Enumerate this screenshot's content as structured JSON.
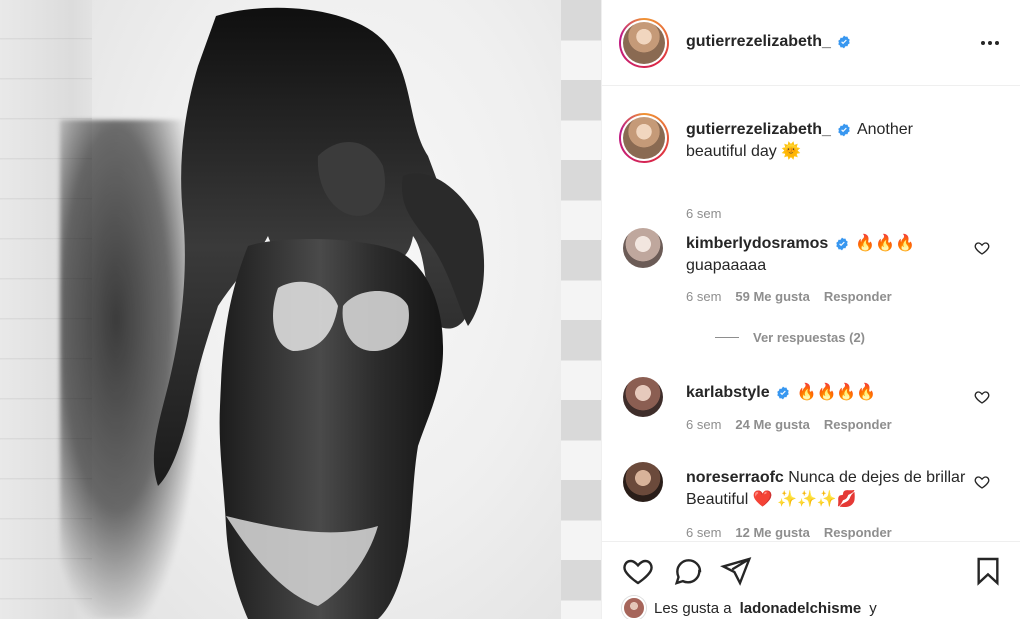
{
  "post": {
    "username": "gutierrezelizabeth_",
    "caption": {
      "username": "gutierrezelizabeth_",
      "text": "Another beautiful day",
      "emoji": "🌞",
      "time": "6 sem"
    }
  },
  "comments": [
    {
      "username": "kimberlydosramos",
      "verified": true,
      "text": "🔥🔥🔥 guapaaaaa",
      "time": "6 sem",
      "likes": "59 Me gusta",
      "reply_label": "Responder"
    },
    {
      "username": "karlabstyle",
      "verified": true,
      "text": "🔥🔥🔥🔥",
      "time": "6 sem",
      "likes": "24 Me gusta",
      "reply_label": "Responder"
    },
    {
      "username": "noreserraofc",
      "verified": false,
      "text": "Nunca de dejes de brillar Beautiful ❤️ ✨✨✨💋",
      "time": "6 sem",
      "likes": "12 Me gusta",
      "reply_label": "Responder"
    }
  ],
  "view_replies_label": "Ver respuestas (2)",
  "likes_line": {
    "prefix": "Les gusta a",
    "username": "ladonadelchisme",
    "suffix": "y"
  },
  "icons": {
    "more": "more-dots-icon",
    "verified": "verified-badge-icon",
    "heart": "heart-icon",
    "comment": "comment-icon",
    "share": "share-icon",
    "save": "bookmark-icon"
  },
  "colors": {
    "verified": "#3897f0",
    "text": "#262626",
    "muted": "#8e8e8e",
    "border": "#efefef"
  }
}
